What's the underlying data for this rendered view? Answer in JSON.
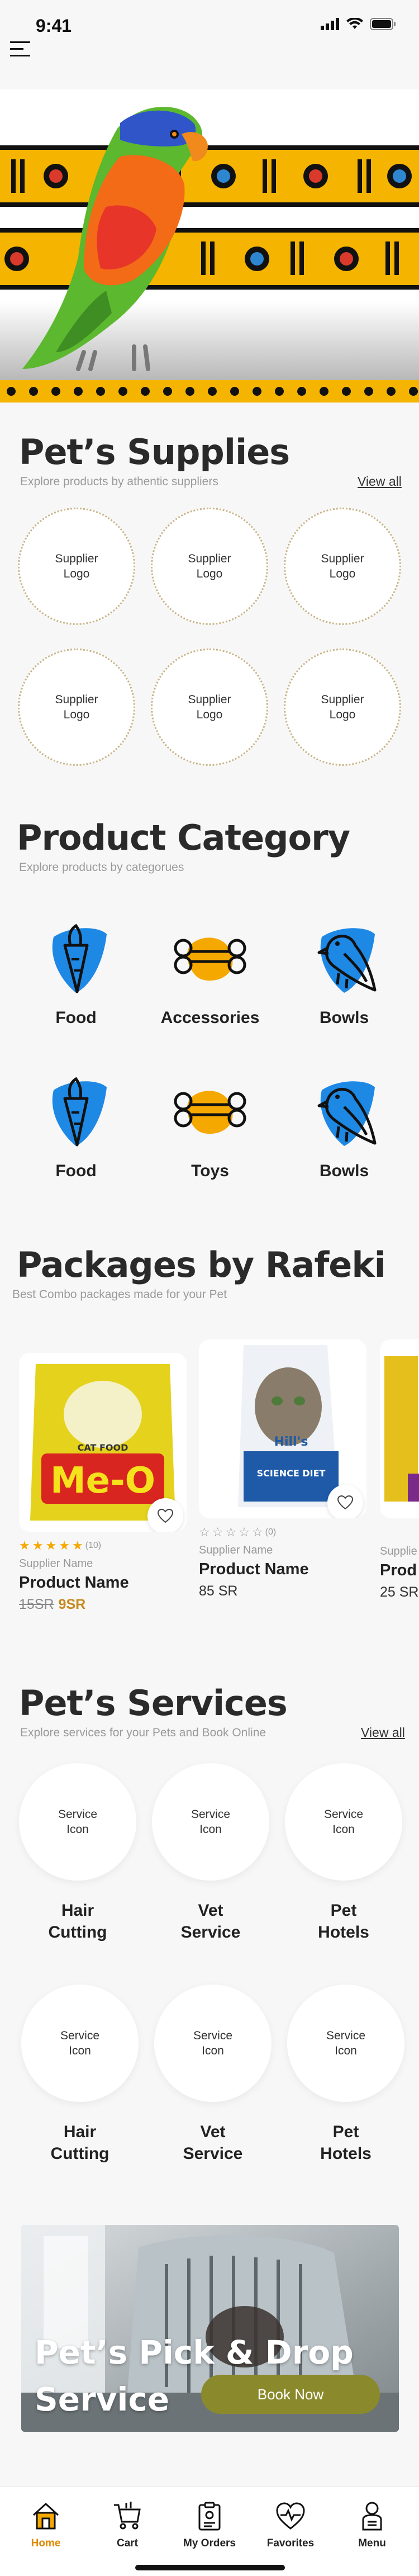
{
  "status_bar": {
    "time": "9:41"
  },
  "colors": {
    "accent": "#F5A800",
    "blue": "#1E88E5",
    "nav_active": "#E08A00",
    "button": "#8A8A2C"
  },
  "hero": {
    "image": "parrot-banner"
  },
  "supplies": {
    "title": "Pet’s Supplies",
    "subtitle": "Explore products by athentic suppliers",
    "view_all": "View all",
    "suppliers": [
      {
        "line1": "Supplier",
        "line2": "Logo"
      },
      {
        "line1": "Supplier",
        "line2": "Logo"
      },
      {
        "line1": "Supplier",
        "line2": "Logo"
      },
      {
        "line1": "Supplier",
        "line2": "Logo"
      },
      {
        "line1": "Supplier",
        "line2": "Logo"
      },
      {
        "line1": "Supplier",
        "line2": "Logo"
      }
    ]
  },
  "category": {
    "title": "Product Category",
    "subtitle": "Explore products by categorues",
    "items": [
      {
        "label": "Food",
        "icon": "carrot-icon"
      },
      {
        "label": "Accessories",
        "icon": "bone-icon"
      },
      {
        "label": "Bowls",
        "icon": "bird-icon"
      },
      {
        "label": "Food",
        "icon": "carrot-icon"
      },
      {
        "label": "Toys",
        "icon": "bone-icon"
      },
      {
        "label": "Bowls",
        "icon": "bird-icon"
      }
    ]
  },
  "packages": {
    "title": "Packages by Rafeki",
    "subtitle": "Best Combo packages made for your Pet",
    "items": [
      {
        "image_text": "Me-O",
        "image_sub": "CAT FOOD",
        "rating": 5,
        "reviews": "(10)",
        "supplier": "Supplier Name",
        "name": "Product Name",
        "old_price": "15SR",
        "price": "9SR"
      },
      {
        "image_text": "Hill's",
        "image_sub": "SCIENCE DIET",
        "rating": 0,
        "reviews": "(0)",
        "supplier": "Supplier Name",
        "name": "Product Name",
        "old_price": "",
        "price": "85 SR"
      },
      {
        "image_text": "",
        "image_sub": "",
        "rating": 0,
        "reviews": "",
        "supplier": "Supplie",
        "name": "Prod",
        "old_price": "",
        "price": "25 SR"
      }
    ]
  },
  "services": {
    "title": "Pet’s Services",
    "subtitle": "Explore services for your Pets and Book Online",
    "view_all": "View all",
    "items": [
      {
        "icon_line1": "Service",
        "icon_line2": "Icon",
        "label1": "Hair",
        "label2": "Cutting"
      },
      {
        "icon_line1": "Service",
        "icon_line2": "Icon",
        "label1": "Vet",
        "label2": "Service"
      },
      {
        "icon_line1": "Service",
        "icon_line2": "Icon",
        "label1": "Pet",
        "label2": "Hotels"
      },
      {
        "icon_line1": "Service",
        "icon_line2": "Icon",
        "label1": "Hair",
        "label2": "Cutting"
      },
      {
        "icon_line1": "Service",
        "icon_line2": "Icon",
        "label1": "Vet",
        "label2": "Service"
      },
      {
        "icon_line1": "Service",
        "icon_line2": "Icon",
        "label1": "Pet",
        "label2": "Hotels"
      }
    ]
  },
  "banner": {
    "title_line1": "Pet’s Pick & Drop",
    "title_line2": "Service",
    "button": "Book Now"
  },
  "nav": {
    "items": [
      {
        "label": "Home",
        "icon": "home-icon",
        "active": true
      },
      {
        "label": "Cart",
        "icon": "cart-icon",
        "active": false
      },
      {
        "label": "My Orders",
        "icon": "orders-icon",
        "active": false
      },
      {
        "label": "Favorites",
        "icon": "heart-icon",
        "active": false
      },
      {
        "label": "Menu",
        "icon": "menu-person-icon",
        "active": false
      }
    ]
  }
}
